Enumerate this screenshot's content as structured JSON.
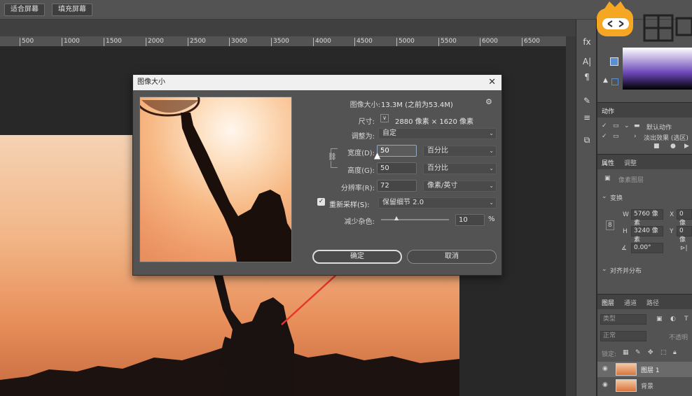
{
  "options_bar": {
    "fit_screen": "适合屏幕",
    "fill_screen": "填充屏幕"
  },
  "ruler": {
    "ticks": [
      "500",
      "1000",
      "1500",
      "2000",
      "2500",
      "3000",
      "3500",
      "4000",
      "4500",
      "5000",
      "5500",
      "6000",
      "6500"
    ]
  },
  "dialog": {
    "title": "图像大小",
    "image_size_label": "图像大小:",
    "image_size_value": "13.3M (之前为53.4M)",
    "dimensions_label": "尺寸:",
    "dimensions_value": "2880 像素 × 1620 像素",
    "fit_to_label": "调整为:",
    "fit_to_value": "自定",
    "width_label": "宽度(D):",
    "width_value": "50",
    "width_unit": "百分比",
    "height_label": "高度(G):",
    "height_value": "50",
    "height_unit": "百分比",
    "resolution_label": "分辨率(R):",
    "resolution_value": "72",
    "resolution_unit": "像素/英寸",
    "resample_label": "重新采样(S):",
    "resample_value": "保留细节 2.0",
    "resample_checked": true,
    "noise_label": "减少杂色:",
    "noise_value": "10",
    "noise_unit": "%",
    "noise_slider_level": 0.1,
    "ok_label": "确定",
    "cancel_label": "取消"
  },
  "right_panel": {
    "actions_tab": "动作",
    "actions_default": "默认动作",
    "actions_item2": "淡出效果 (选区)",
    "properties_tab": "属性",
    "adjust_tab": "调整",
    "pixel_layer": "像素图层",
    "transform_label": "变换",
    "w_label": "W",
    "w_value": "5760 像素",
    "h_label": "H",
    "h_value": "3240 像素",
    "x_label": "X",
    "x_value": "0 像",
    "y_label": "Y",
    "y_value": "0 像",
    "angle_value": "0.00°",
    "align_label": "对齐并分布",
    "layers_tab": "图层",
    "channels_tab": "通道",
    "paths_tab": "路径",
    "kind_label": "类型",
    "blend_mode": "正常",
    "opacity_label": "不透明",
    "lock_label": "锁定:",
    "layer1_name": "图层 1",
    "background_name": "背景"
  },
  "colors": {
    "accent": "#f5a623",
    "selection": "#93a7c3",
    "arrow": "#e8352b"
  }
}
